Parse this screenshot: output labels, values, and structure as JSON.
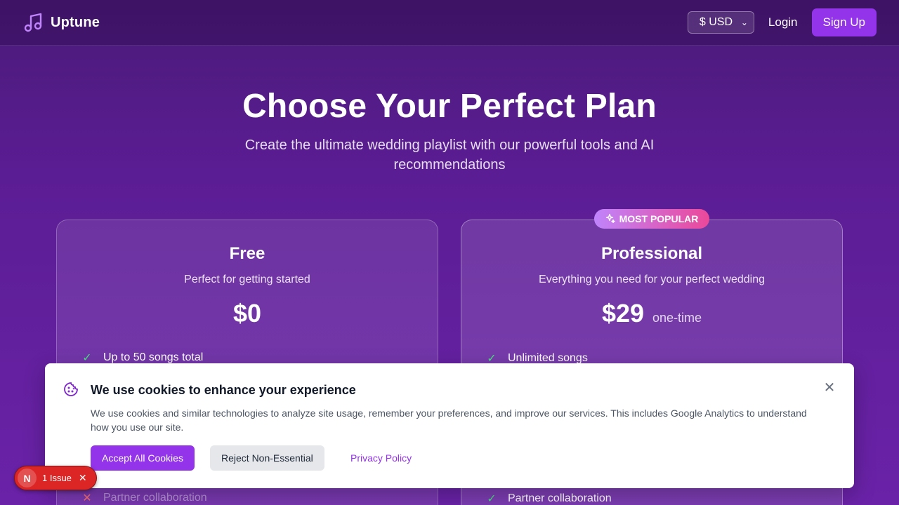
{
  "header": {
    "brand": "Uptune",
    "currency": "$ USD",
    "login": "Login",
    "signup": "Sign Up"
  },
  "hero": {
    "title": "Choose Your Perfect Plan",
    "subtitle": "Create the ultimate wedding playlist with our powerful tools and AI recommendations"
  },
  "plans": [
    {
      "name": "Free",
      "description": "Perfect for getting started",
      "price": "$0",
      "period": "",
      "features": [
        {
          "label": "Up to 50 songs total",
          "included": true
        },
        {
          "label": "Partner collaboration",
          "included": false
        }
      ]
    },
    {
      "name": "Professional",
      "badge": "MOST POPULAR",
      "description": "Everything you need for your perfect wedding",
      "price": "$29",
      "period": "one-time",
      "features": [
        {
          "label": "Unlimited songs",
          "included": true
        },
        {
          "label": "Partner collaboration",
          "included": true
        }
      ]
    }
  ],
  "cookie": {
    "title": "We use cookies to enhance your experience",
    "text": "We use cookies and similar technologies to analyze site usage, remember your preferences, and improve our services. This includes Google Analytics to understand how you use our site.",
    "accept": "Accept All Cookies",
    "reject": "Reject Non-Essential",
    "privacy": "Privacy Policy"
  },
  "issue": {
    "logo": "N",
    "label": "1 Issue"
  },
  "colors": {
    "accent": "#9333ea",
    "check": "#4ade80",
    "cross": "#f87171",
    "issue": "#dc2626"
  },
  "icons": [
    "music-note-icon",
    "chevron-down-icon",
    "sparkles-icon",
    "check-icon",
    "x-icon",
    "cookie-icon",
    "close-icon"
  ]
}
